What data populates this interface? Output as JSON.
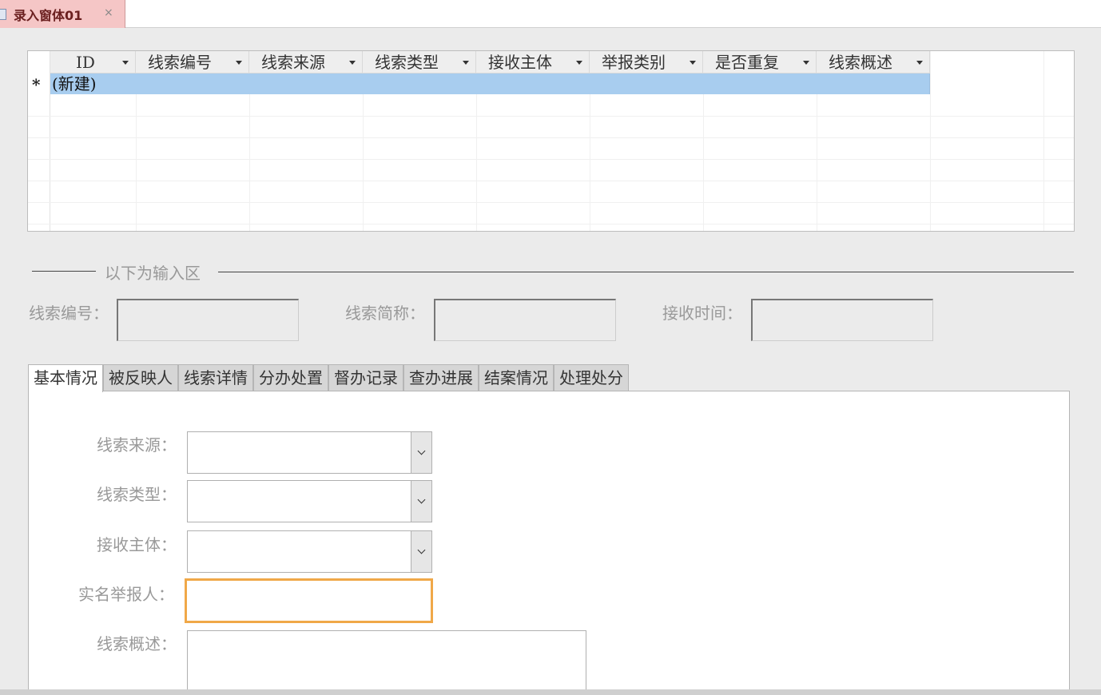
{
  "document_tab": {
    "title": "录入窗体01",
    "close": "×"
  },
  "grid": {
    "columns": [
      "ID",
      "线索编号",
      "线索来源",
      "线索类型",
      "接收主体",
      "举报类别",
      "是否重复",
      "线索概述"
    ],
    "new_row_marker": "*",
    "new_row_text": "(新建)"
  },
  "section_label": "以下为输入区",
  "top_fields": {
    "clue_no": "线索编号：",
    "clue_short": "线索简称：",
    "receive_time": "接收时间："
  },
  "tabs": [
    "基本情况",
    "被反映人",
    "线索详情",
    "分办处置",
    "督办记录",
    "查办进展",
    "结案情况",
    "处理处分"
  ],
  "active_tab": "基本情况",
  "basic_form": {
    "source": "线索来源：",
    "type": "线索类型：",
    "receiver": "接收主体：",
    "reporter": "实名举报人：",
    "summary": "线索概述："
  },
  "colors": {
    "accent_focus": "#f0a848",
    "selection": "#a8cdef",
    "doc_tab": "#f5c6c6"
  }
}
